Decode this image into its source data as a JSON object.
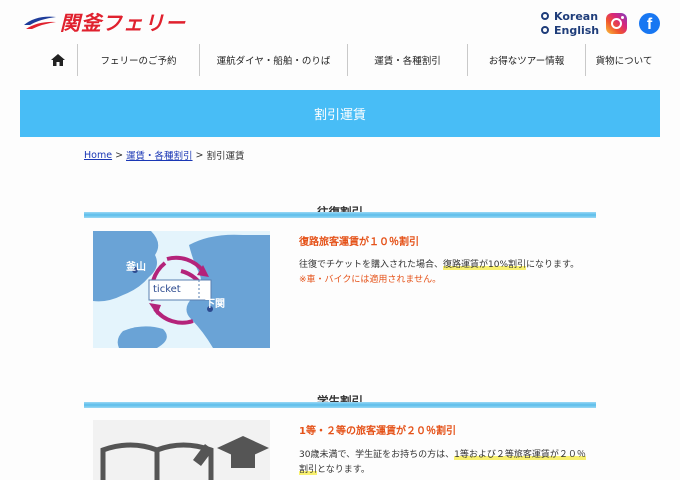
{
  "header": {
    "logo_text": "関釜フェリー",
    "languages": [
      "Korean",
      "English"
    ],
    "social": [
      "instagram-icon",
      "facebook-icon"
    ],
    "facebook_glyph": "f"
  },
  "nav": {
    "items": [
      "フェリーのご予約",
      "運航ダイヤ・船舶・のりば",
      "運賃・各種割引",
      "お得なツアー情報",
      "貨物について"
    ]
  },
  "banner": {
    "title": "割引運賃"
  },
  "breadcrumb": {
    "home": "Home",
    "sep": ">",
    "parent": "運賃・各種割引",
    "current": "割引運賃"
  },
  "sections": [
    {
      "title": "往復割引",
      "offer": "復路旅客運賃が１０％割引",
      "desc_prefix": "往復でチケットを購入された場合、",
      "desc_highlight": "復路運賃が10%割引",
      "desc_suffix": "になります。",
      "note": "※車・バイクには適用されません。",
      "image": {
        "port_a": "釜山",
        "port_b": "下関",
        "ticket": "ticket"
      }
    },
    {
      "title": "学生割引",
      "offer": "1等・２等の旅客運賃が２０％割引",
      "desc_line1_prefix": "30歳未満で、学生証をお持ちの方は、",
      "desc_line1_highlight": "1等および２等旅客運賃が２０％",
      "desc_line2_highlight": "割引",
      "desc_line2_suffix": "となります。"
    }
  ],
  "colors": {
    "brand_red": "#e0212e",
    "banner_blue": "#48bdf6",
    "accent_orange": "#e5531a",
    "link_blue": "#1a37b5"
  }
}
